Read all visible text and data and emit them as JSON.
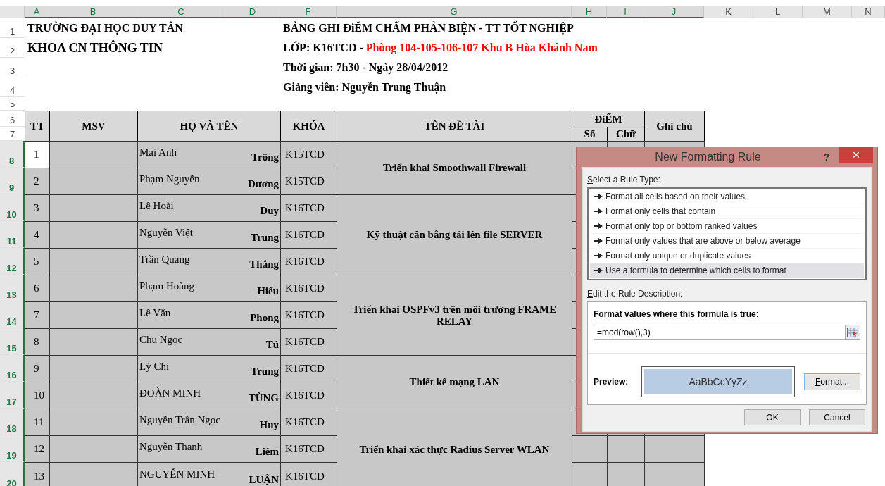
{
  "columns": [
    {
      "label": "A",
      "selected": true
    },
    {
      "label": "B",
      "selected": true
    },
    {
      "label": "C",
      "selected": true
    },
    {
      "label": "D",
      "selected": true
    },
    {
      "label": "F",
      "selected": true
    },
    {
      "label": "G",
      "selected": true
    },
    {
      "label": "H",
      "selected": true
    },
    {
      "label": "I",
      "selected": true
    },
    {
      "label": "J",
      "selected": true
    },
    {
      "label": "K",
      "selected": false
    },
    {
      "label": "L",
      "selected": false
    },
    {
      "label": "M",
      "selected": false
    },
    {
      "label": "N",
      "selected": false
    }
  ],
  "row_numbers": [
    {
      "label": "1",
      "selected": false
    },
    {
      "label": "2",
      "selected": false
    },
    {
      "label": "3",
      "selected": false
    },
    {
      "label": "4",
      "selected": false
    },
    {
      "label": "5",
      "selected": false
    },
    {
      "label": "6",
      "selected": false
    },
    {
      "label": "7",
      "selected": false
    },
    {
      "label": "8",
      "selected": true
    },
    {
      "label": "9",
      "selected": true
    },
    {
      "label": "10",
      "selected": true
    },
    {
      "label": "11",
      "selected": true
    },
    {
      "label": "12",
      "selected": true
    },
    {
      "label": "13",
      "selected": true
    },
    {
      "label": "14",
      "selected": true
    },
    {
      "label": "15",
      "selected": true
    },
    {
      "label": "16",
      "selected": true
    },
    {
      "label": "17",
      "selected": true
    },
    {
      "label": "18",
      "selected": true
    },
    {
      "label": "19",
      "selected": true
    },
    {
      "label": "20",
      "selected": true
    }
  ],
  "school": "TRƯỜNG ĐẠI HỌC DUY TÂN",
  "faculty": "KHOA CN THÔNG TIN",
  "sheet_title": "BẢNG GHI ĐiỂM CHẤM PHẢN BIỆN - TT TỐT NGHIỆP",
  "class_line": {
    "label": "LỚP: K16TCD -",
    "room": "Phòng 104-105-106-107 Khu B Hòa Khánh Nam"
  },
  "time_line": "Thời gian: 7h30 - Ngày 28/04/2012",
  "lecturer_line": "Giảng viên: Nguyễn Trung Thuận",
  "table_headers": {
    "tt": "TT",
    "msv": "MSV",
    "name": "HỌ VÀ TÊN",
    "course": "KHÓA",
    "topic": "TÊN ĐỀ TÀI",
    "score": "ĐiỂM",
    "score_number": "Số",
    "score_words": "Chữ",
    "note": "Ghi chú"
  },
  "topics": [
    {
      "title": "Triển khai Smoothwall Firewall",
      "students": [
        {
          "tt": "1",
          "surname": "Mai Anh",
          "given": "Trông",
          "course": "K15TCD",
          "selected": true
        },
        {
          "tt": "2",
          "surname": "Phạm Nguyễn",
          "given": "Dương",
          "course": "K15TCD",
          "selected": false
        }
      ]
    },
    {
      "title": "Kỹ thuật cân bằng tải lên file SERVER",
      "students": [
        {
          "tt": "3",
          "surname": "Lê Hoài",
          "given": "Duy",
          "course": "K16TCD",
          "selected": false
        },
        {
          "tt": "4",
          "surname": "Nguyễn Việt",
          "given": "Trung",
          "course": "K16TCD",
          "selected": false
        },
        {
          "tt": "5",
          "surname": "Trần Quang",
          "given": "Thắng",
          "course": "K16TCD",
          "selected": false
        }
      ]
    },
    {
      "title": "Triển khai OSPFv3 trên môi trường FRAME RELAY",
      "students": [
        {
          "tt": "6",
          "surname": "Phạm Hoàng",
          "given": "Hiếu",
          "course": "K16TCD",
          "selected": false
        },
        {
          "tt": "7",
          "surname": "Lê Văn",
          "given": "Phong",
          "course": "K16TCD",
          "selected": false
        },
        {
          "tt": "8",
          "surname": "Chu Ngọc",
          "given": "Tú",
          "course": "K16TCD",
          "selected": false
        }
      ]
    },
    {
      "title": "Thiết kế mạng LAN",
      "students": [
        {
          "tt": "9",
          "surname": "Lý Chi",
          "given": "Trung",
          "course": "K16TCD",
          "selected": false
        },
        {
          "tt": "10",
          "surname": "ĐOÀN MINH",
          "given": "TÙNG",
          "course": "K16TCD",
          "selected": false
        }
      ]
    },
    {
      "title": "Triển khai xác thực Radius Server WLAN",
      "students": [
        {
          "tt": "11",
          "surname": "Nguyễn Trần Ngọc",
          "given": "Huy",
          "course": "K16TCD",
          "selected": false
        },
        {
          "tt": "12",
          "surname": "Nguyễn Thanh",
          "given": "Liêm",
          "course": "K16TCD",
          "selected": false
        },
        {
          "tt": "13",
          "surname": "NGUYỄN MINH",
          "given": "LUẬN",
          "course": "K16TCD",
          "selected": false
        }
      ]
    }
  ],
  "dialog": {
    "title": "New Formatting Rule",
    "help": "?",
    "close": "×",
    "rule_type_label": "Select a Rule Type:",
    "rule_types": [
      {
        "label": "Format all cells based on their values",
        "selected": false
      },
      {
        "label": "Format only cells that contain",
        "selected": false
      },
      {
        "label": "Format only top or bottom ranked values",
        "selected": false
      },
      {
        "label": "Format only values that are above or below average",
        "selected": false
      },
      {
        "label": "Format only unique or duplicate values",
        "selected": false
      },
      {
        "label": "Use a formula to determine which cells to format",
        "selected": true
      }
    ],
    "description_label": "Edit the Rule Description:",
    "formula_label": "Format values where this formula is true:",
    "formula": "=mod(row(),3)",
    "preview_label": "Preview:",
    "preview_sample": "AaBbCcYyZz",
    "format_button": "Format...",
    "ok_button": "OK",
    "cancel_button": "Cancel"
  }
}
